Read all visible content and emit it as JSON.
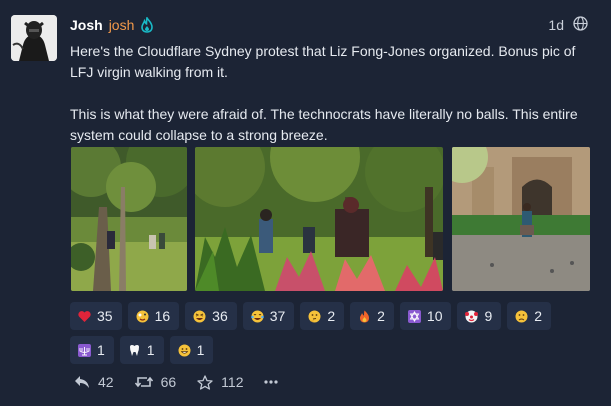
{
  "post": {
    "display_name": "Josh",
    "handle": "josh",
    "timestamp": "1d",
    "paragraphs": [
      "Here's the Cloudflare Sydney protest that Liz Fong-Jones organized. Bonus pic of LFJ virgin walking from it.",
      "This is what they were afraid of. The technocrats have literally no balls. This entire system could collapse to a strong breeze."
    ]
  },
  "reactions": [
    {
      "emoji": "red-heart",
      "count": "35"
    },
    {
      "emoji": "zany-face",
      "count": "16"
    },
    {
      "emoji": "squinting-laugh",
      "count": "36"
    },
    {
      "emoji": "tears-of-joy",
      "count": "37"
    },
    {
      "emoji": "thinking-face",
      "count": "2"
    },
    {
      "emoji": "fire",
      "count": "2"
    },
    {
      "emoji": "star-of-david",
      "count": "10"
    },
    {
      "emoji": "clown-face",
      "count": "9"
    },
    {
      "emoji": "sad-face",
      "count": "2"
    },
    {
      "emoji": "menorah",
      "count": "1"
    },
    {
      "emoji": "tooth",
      "count": "1"
    },
    {
      "emoji": "grinning-face",
      "count": "1"
    }
  ],
  "actions": {
    "replies": "42",
    "reposts": "66",
    "likes": "112"
  },
  "colors": {
    "background": "#1c2435",
    "reaction_bg": "#253047",
    "handle": "#f2994a",
    "flame": "#19b9c6"
  }
}
